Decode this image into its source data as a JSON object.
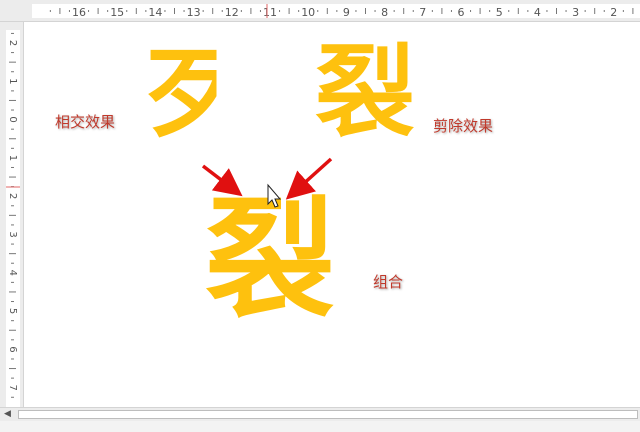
{
  "ruler": {
    "horizontal_labels": [
      "16",
      "15",
      "14",
      "13",
      "12",
      "11",
      "10",
      "9",
      "8",
      "7",
      "6",
      "5",
      "4",
      "3",
      "2"
    ],
    "vertical_labels": [
      "2",
      "1",
      "0",
      "1",
      "2",
      "3",
      "4",
      "5",
      "6",
      "7"
    ]
  },
  "slide": {
    "label_intersect": "相交效果",
    "label_subtract": "剪除效果",
    "label_combine": "组合",
    "glyph_intersect": "歹",
    "glyph_subtract": "裂",
    "glyph_combine": "裂"
  },
  "colors": {
    "glyph": "#fec10e",
    "label": "#c0392b",
    "arrow": "#e01010"
  }
}
